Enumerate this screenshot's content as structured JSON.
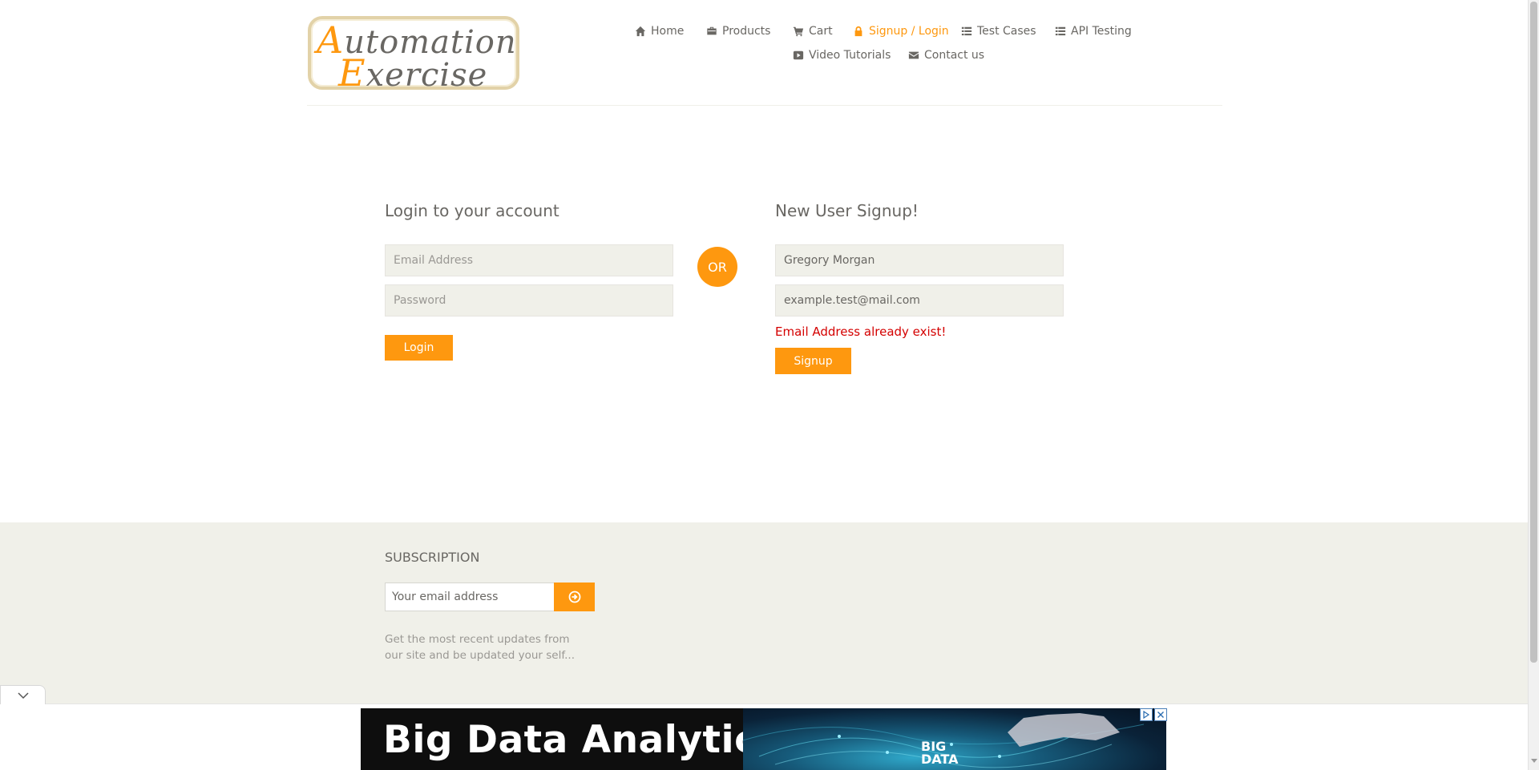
{
  "logo": {
    "line1_cap": "A",
    "line1_rest": "utomation",
    "line2_cap": "E",
    "line2_rest": "xercise"
  },
  "nav": {
    "items": [
      {
        "label": "Home",
        "icon": "home-icon"
      },
      {
        "label": "Products",
        "icon": "briefcase-icon"
      },
      {
        "label": "Cart",
        "icon": "cart-icon"
      },
      {
        "label": "Signup / Login",
        "icon": "lock-icon",
        "active": true
      },
      {
        "label": "Test Cases",
        "icon": "list-icon"
      },
      {
        "label": "API Testing",
        "icon": "list-icon"
      },
      {
        "label": "Video Tutorials",
        "icon": "youtube-play-icon"
      },
      {
        "label": "Contact us",
        "icon": "envelope-icon"
      }
    ]
  },
  "login": {
    "title": "Login to your account",
    "email_placeholder": "Email Address",
    "password_placeholder": "Password",
    "button": "Login"
  },
  "or_label": "OR",
  "signup": {
    "title": "New User Signup!",
    "name_value": "Gregory Morgan",
    "email_value": "example.test@mail.com",
    "error": "Email Address already exist!",
    "button": "Signup"
  },
  "subscription": {
    "title": "SUBSCRIPTION",
    "placeholder": "Your email address",
    "description": "Get the most recent updates from our site and be updated your self..."
  },
  "ad": {
    "headline": "Big Data Analytics",
    "image_text_line1": "BIG",
    "image_text_line2": "DATA"
  },
  "colors": {
    "accent": "#fe980f",
    "error": "#d40000",
    "text": "#696763",
    "field_bg": "#f0f0e9"
  }
}
